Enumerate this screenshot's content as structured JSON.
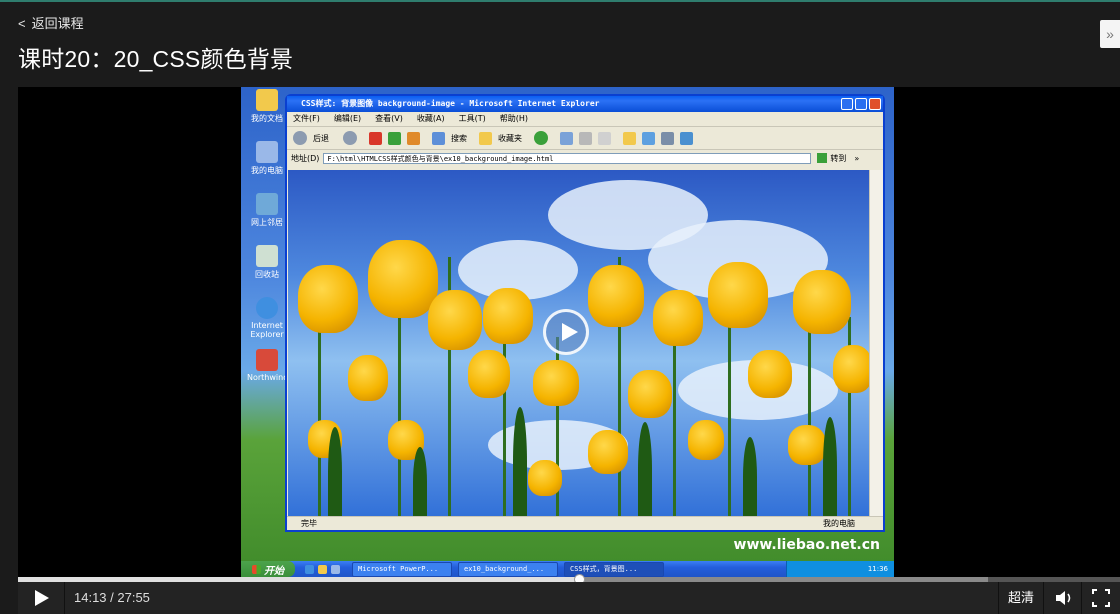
{
  "header": {
    "back_label": "返回课程",
    "back_chevron": "<",
    "title": "课时20：20_CSS颜色背景",
    "side_toggle_glyph": "»"
  },
  "video_frame": {
    "desktop_icons": [
      "我的文档",
      "我的电脑",
      "网上邻居",
      "回收站",
      "Internet Explorer",
      "Northwind"
    ],
    "ie_window": {
      "title": "CSS样式: 背景图像 background-image - Microsoft Internet Explorer",
      "menu": [
        "文件(F)",
        "编辑(E)",
        "查看(V)",
        "收藏(A)",
        "工具(T)",
        "帮助(H)"
      ],
      "toolbar": {
        "back": "后退",
        "search": "搜索",
        "favorites": "收藏夹"
      },
      "address_label": "地址(D)",
      "address_value": "F:\\html\\HTMLCSS样式颜色与背景\\ex10_background_image.html",
      "go_label": "转到",
      "links_label": "»",
      "status_text": "完毕",
      "status_zone": "我的电脑"
    },
    "watermark": "www.liebao.net.cn",
    "taskbar": {
      "start": "开始",
      "buttons": [
        "Microsoft PowerP...",
        "ex10_background_...",
        "CSS样式，背景图..."
      ],
      "clock": "11:36"
    }
  },
  "player": {
    "current_time": "14:13",
    "duration": "27:55",
    "time_display": "14:13 / 27:55",
    "progress_fraction": 0.509,
    "buffered_fraction": 0.88,
    "quality_label": "超清"
  },
  "colors": {
    "accent_line": "#2f7d6e",
    "background": "#1b1b1b"
  },
  "icons": [
    "play-icon",
    "volume-icon",
    "fullscreen-icon",
    "big-play-icon",
    "expand-sidebar-icon"
  ]
}
